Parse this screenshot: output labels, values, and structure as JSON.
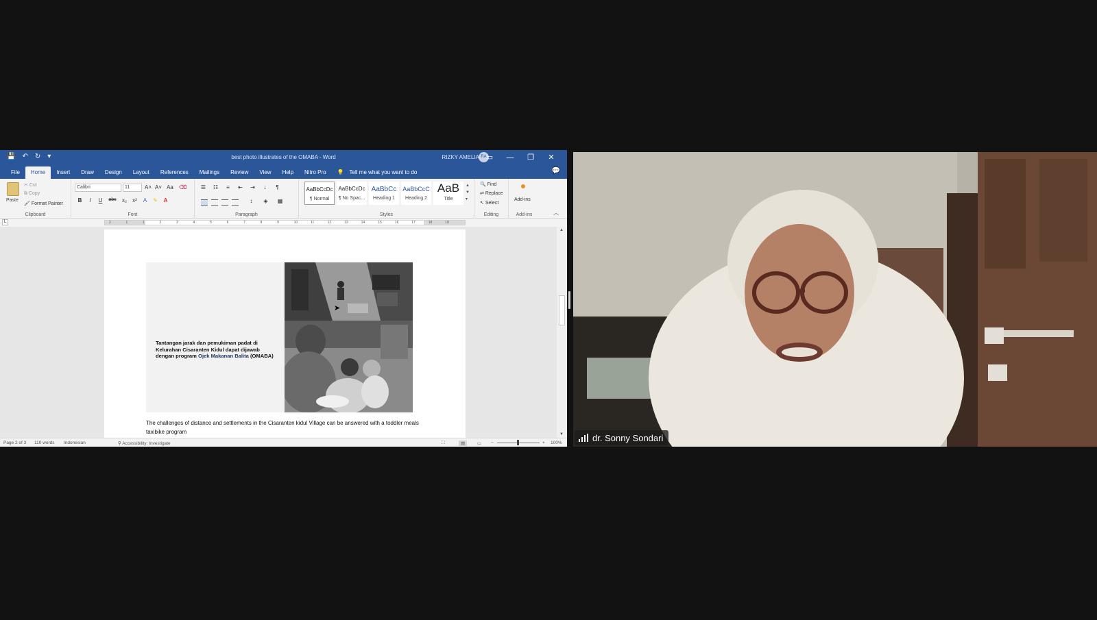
{
  "word": {
    "qat": {
      "save_icon": "save-icon",
      "undo_icon": "undo-icon",
      "redo_icon": "redo-icon",
      "customize": "▾"
    },
    "title": "best photo illustrates of the OMABA  -  Word",
    "user_name": "RIZKY AMELIA",
    "user_initials": "RA",
    "window_buttons": [
      "▭",
      "—",
      "❐",
      "✕"
    ],
    "tabs": [
      "File",
      "Home",
      "Insert",
      "Draw",
      "Design",
      "Layout",
      "References",
      "Mailings",
      "Review",
      "View",
      "Help",
      "Nitro Pro"
    ],
    "active_tab": "Home",
    "tell_me": "Tell me what you want to do",
    "ribbon": {
      "clipboard": {
        "paste": "Paste",
        "cut": "Cut",
        "copy": "Copy",
        "format_painter": "Format Painter",
        "label": "Clipboard"
      },
      "font": {
        "name": "Calibri",
        "size": "11",
        "grow": "A˄",
        "shrink": "A˅",
        "case": "Aa",
        "bold": "B",
        "italic": "I",
        "underline": "U",
        "strike": "abc",
        "sub": "x₂",
        "sup": "x²",
        "label": "Font"
      },
      "paragraph": {
        "label": "Paragraph",
        "pilcrow": "¶"
      },
      "styles": {
        "items": [
          {
            "sample": "AaBbCcDc",
            "name": "¶ Normal"
          },
          {
            "sample": "AaBbCcDc",
            "name": "¶ No Spac..."
          },
          {
            "sample": "AaBbCc",
            "name": "Heading 1"
          },
          {
            "sample": "AaBbCcC",
            "name": "Heading 2"
          },
          {
            "sample": "AaB",
            "name": "Title"
          }
        ],
        "label": "Styles"
      },
      "editing": {
        "find": "Find",
        "replace": "Replace",
        "select": "Select",
        "label": "Editing"
      },
      "addins": {
        "button": "Add-ins",
        "label": "Add-ins"
      }
    },
    "ruler_ticks": [
      "2",
      "1",
      "1",
      "2",
      "3",
      "4",
      "5",
      "6",
      "7",
      "8",
      "9",
      "10",
      "11",
      "12",
      "13",
      "14",
      "15",
      "16",
      "17",
      "18",
      "19"
    ],
    "tab_selector": "L",
    "document": {
      "caption_pre": "Tantangan jarak dan pemukiman padat di Kelurahan Cisaranten  Kidul dapat dijawab dengan program ",
      "caption_highlight": "Ojek Makanan Balita",
      "caption_post": " (OMABA)",
      "body": "The challenges of distance and settlements in the Cisaranten kidul Village can be answered with a toddler meals taxibike program"
    },
    "status": {
      "page": "Page 2 of 3",
      "words": "110 words",
      "language": "Indonesian",
      "accessibility": "Accessibility: Investigate",
      "zoom": "100%"
    }
  },
  "video": {
    "participant_name": "dr. Sonny Sondari",
    "icons": [
      "signal-icon"
    ]
  },
  "colors": {
    "word_blue": "#2b579a",
    "background": "#121212",
    "highlight_text": "#1f3864"
  }
}
